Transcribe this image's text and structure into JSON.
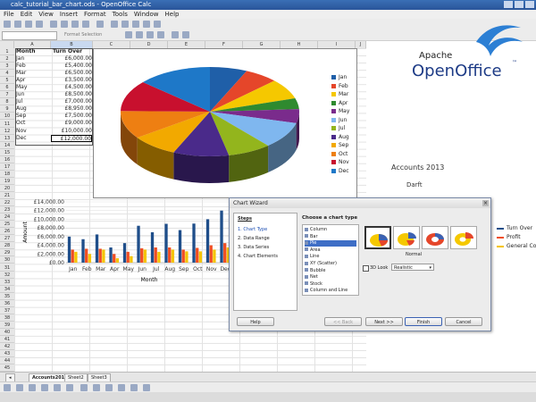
{
  "window": {
    "title": "calc_tutorial_bar_chart.ods - OpenOffice Calc"
  },
  "menu": [
    "File",
    "Edit",
    "View",
    "Insert",
    "Format",
    "Tools",
    "Window",
    "Help"
  ],
  "toolbar": {
    "format_selection": "Format Selection"
  },
  "columns": [
    "A",
    "B",
    "C",
    "D",
    "E",
    "F",
    "G",
    "H",
    "I",
    "J"
  ],
  "rows": [
    "1",
    "2",
    "3",
    "4",
    "5",
    "6",
    "7",
    "8",
    "9",
    "10",
    "11",
    "12",
    "13",
    "14",
    "15",
    "16",
    "17",
    "18",
    "19",
    "20",
    "21",
    "22",
    "23",
    "24",
    "25",
    "26",
    "27",
    "28",
    "29",
    "30",
    "31",
    "32",
    "33",
    "34",
    "35",
    "36",
    "37",
    "38",
    "39",
    "40",
    "41",
    "42",
    "43",
    "44",
    "45"
  ],
  "table": {
    "header_month": "Month",
    "header_turnover": "Turn Over",
    "rows": [
      {
        "month": "Jan",
        "value": "£6,000.00"
      },
      {
        "month": "Feb",
        "value": "£5,400.00"
      },
      {
        "month": "Mar",
        "value": "£6,500.00"
      },
      {
        "month": "Apr",
        "value": "£3,500.00"
      },
      {
        "month": "May",
        "value": "£4,500.00"
      },
      {
        "month": "Jun",
        "value": "£8,500.00"
      },
      {
        "month": "Jul",
        "value": "£7,000.00"
      },
      {
        "month": "Aug",
        "value": "£8,950.00"
      },
      {
        "month": "Sep",
        "value": "£7,500.00"
      },
      {
        "month": "Oct",
        "value": "£9,000.00"
      },
      {
        "month": "Nov",
        "value": "£10,000.00"
      },
      {
        "month": "Dec",
        "value": "£12,000.00"
      }
    ]
  },
  "pie_legend": [
    {
      "label": "Jan",
      "color": "#1f5fa8"
    },
    {
      "label": "Feb",
      "color": "#e5462a"
    },
    {
      "label": "Mar",
      "color": "#f5c800"
    },
    {
      "label": "Apr",
      "color": "#2f8a2f"
    },
    {
      "label": "May",
      "color": "#7a2b8c"
    },
    {
      "label": "Jun",
      "color": "#7fb7ef"
    },
    {
      "label": "Jul",
      "color": "#93b51d"
    },
    {
      "label": "Aug",
      "color": "#4a2a8a"
    },
    {
      "label": "Sep",
      "color": "#f2a900"
    },
    {
      "label": "Oct",
      "color": "#ee7f12"
    },
    {
      "label": "Nov",
      "color": "#c8102e"
    },
    {
      "label": "Dec",
      "color": "#1e78c8"
    }
  ],
  "chart_data": {
    "type": "bar",
    "categories": [
      "Jan",
      "Feb",
      "Mar",
      "Apr",
      "May",
      "Jun",
      "Jul",
      "Aug",
      "Sep",
      "Oct",
      "Nov",
      "Dec"
    ],
    "series": [
      {
        "name": "Turn Over",
        "color": "#1f4e8a",
        "values": [
          6000,
          5400,
          6500,
          3500,
          4500,
          8500,
          7000,
          8950,
          7500,
          9000,
          10000,
          12000
        ]
      },
      {
        "name": "Profit",
        "color": "#f04e23",
        "values": [
          3000,
          3200,
          3200,
          2000,
          2500,
          3300,
          3500,
          3500,
          3000,
          3400,
          4000,
          4500
        ]
      },
      {
        "name": "General Costs",
        "color": "#f5c400",
        "values": [
          2500,
          2000,
          3000,
          1000,
          1500,
          3000,
          2500,
          3000,
          2600,
          2600,
          3000,
          3500
        ]
      }
    ],
    "ylim": [
      0,
      14000
    ],
    "yticks": [
      "£14,000.00",
      "£12,000.00",
      "£10,000.00",
      "£8,000.00",
      "£6,000.00",
      "£4,000.00",
      "£2,000.00",
      "£0.00"
    ],
    "xlabel": "Month",
    "ylabel": "Amount",
    "legend": [
      "Turn Over",
      "Profit",
      "General Co"
    ]
  },
  "logo": {
    "line1": "Apache",
    "line2": "OpenOffice",
    "tm": "™"
  },
  "accounts": {
    "title": "Accounts 2013",
    "subtitle": "Darft"
  },
  "wizard": {
    "title": "Chart Wizard",
    "steps_header": "Steps",
    "steps": [
      "1. Chart Type",
      "2. Data Range",
      "3. Data Series",
      "4. Chart Elements"
    ],
    "choose_label": "Choose a chart type",
    "types": [
      "Column",
      "Bar",
      "Pie",
      "Area",
      "Line",
      "XY (Scatter)",
      "Bubble",
      "Net",
      "Stock",
      "Column and Line"
    ],
    "selected_type": "Pie",
    "variant_label": "Normal",
    "look_label": "3D Look",
    "look_value": "Realistic",
    "buttons": {
      "help": "Help",
      "back": "<< Back",
      "next": "Next >>",
      "finish": "Finish",
      "cancel": "Cancel"
    }
  },
  "sheets": [
    "Accounts2013",
    "Sheet2",
    "Sheet3"
  ]
}
